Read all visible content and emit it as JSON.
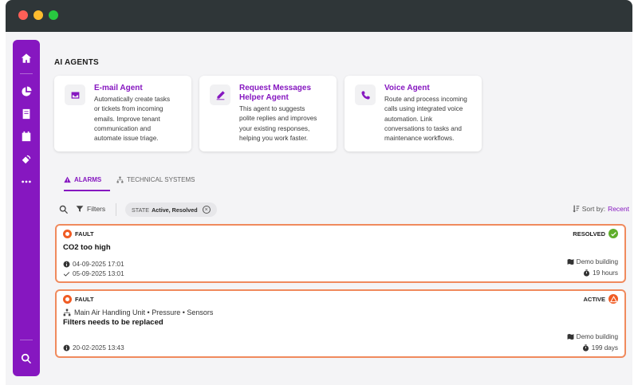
{
  "window": {
    "controls": [
      "close",
      "minimize",
      "maximize"
    ]
  },
  "sidebar": {
    "items": [
      {
        "name": "home-icon"
      },
      {
        "name": "pie-chart-icon"
      },
      {
        "name": "book-icon"
      },
      {
        "name": "calendar-icon"
      },
      {
        "name": "sensor-icon"
      },
      {
        "name": "more-icon"
      },
      {
        "name": "search-icon"
      }
    ]
  },
  "section": {
    "title": "AI AGENTS"
  },
  "agents": [
    {
      "name": "E-mail Agent",
      "icon": "inbox-icon",
      "description": [
        "Automatically create tasks",
        "or tickets from incoming",
        "emails. Improve tenant",
        "communication and",
        "automate issue triage."
      ]
    },
    {
      "name_lines": [
        "Request Messages",
        "Helper Agent"
      ],
      "icon": "pencil-icon",
      "description": [
        "This agent to suggests",
        "polite replies and improves",
        "your existing responses,",
        "helping you work faster."
      ]
    },
    {
      "name": "Voice Agent",
      "icon": "phone-icon",
      "description": [
        "Route and process incoming",
        "calls using integrated voice",
        "automation. Link",
        "conversations to tasks and",
        "maintenance workflows."
      ]
    }
  ],
  "tabs": [
    {
      "label": "ALARMS",
      "icon": "warning-icon",
      "active": true
    },
    {
      "label": "TECHNICAL SYSTEMS",
      "icon": "hierarchy-icon",
      "active": false
    }
  ],
  "filters": {
    "label": "Filters",
    "chip_key": "STATE",
    "chip_value": "Active, Resolved",
    "sort_label": "Sort by:",
    "sort_value": "Recent"
  },
  "alarms": [
    {
      "badge": "FAULT",
      "status": "RESOLVED",
      "title": "CO2 too high",
      "created": "04-09-2025 17:01",
      "resolved": "05-09-2025 13:01",
      "building": "Demo building",
      "duration": "19 hours"
    },
    {
      "badge": "FAULT",
      "status": "ACTIVE",
      "path": "Main Air Handling Unit • Pressure • Sensors",
      "title": "Filters needs to be replaced",
      "created": "20-02-2025 13:43",
      "building": "Demo building",
      "duration": "199 days"
    }
  ],
  "colors": {
    "accent": "#8617c0",
    "fault": "#f05c24",
    "resolved": "#5fae2b",
    "alarm_border": "#f08a5d"
  }
}
